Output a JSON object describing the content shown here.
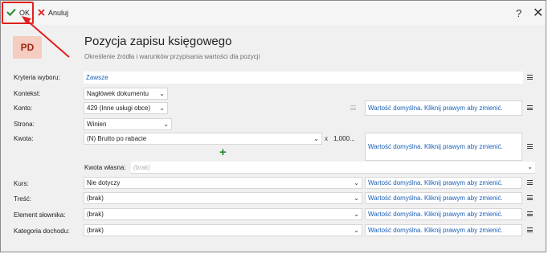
{
  "toolbar": {
    "ok_label": "OK",
    "cancel_label": "Anuluj",
    "help_label": "?",
    "close_label": "✕"
  },
  "header": {
    "logo_text": "PD",
    "title": "Pozycja zapisu księgowego",
    "subtitle": "Określenie źródła i warunków przypisania wartości dla pozycji"
  },
  "form": {
    "kryteria": {
      "label": "Kryteria wyboru:",
      "value": "Zawsze"
    },
    "kontekst": {
      "label": "Kontekst:",
      "value": "Nagłówek dokumentu"
    },
    "konto": {
      "label": "Konto:",
      "value": "429 (Inne usługi obce)",
      "default_text": "Wartość domyślna. Kliknij prawym aby zmienić."
    },
    "strona": {
      "label": "Strona:",
      "value": "Winien"
    },
    "kwota": {
      "label": "Kwota:",
      "value": "(N) Brutto po rabacie",
      "multiplier_sign": "x",
      "multiplier": "1,000...",
      "default_text": "Wartość domyślna. Kliknij prawym aby zmienić."
    },
    "kwota_wlasna": {
      "label": "Kwota własna:",
      "value": "(brak)"
    },
    "kurs": {
      "label": "Kurs:",
      "value": "Nie dotyczy",
      "default_text": "Wartość domyślna. Kliknij prawym aby zmienić."
    },
    "tresc": {
      "label": "Treść:",
      "value": "(brak)",
      "default_text": "Wartość domyślna. Kliknij prawym aby zmienić."
    },
    "element_slownika": {
      "label": "Element słownika:",
      "value": "(brak)",
      "default_text": "Wartość domyślna. Kliknij prawym aby zmienić."
    },
    "kategoria_dochodu": {
      "label": "Kategoria dochodu:",
      "value": "(brak)",
      "default_text": "Wartość domyślna. Kliknij prawym aby zmienić."
    }
  },
  "colors": {
    "accent_blue": "#1a5fb4",
    "highlight_red": "#e02020",
    "ok_green": "#1f8a2a",
    "logo_bg": "#f4ccc0",
    "logo_text": "#a02818"
  }
}
